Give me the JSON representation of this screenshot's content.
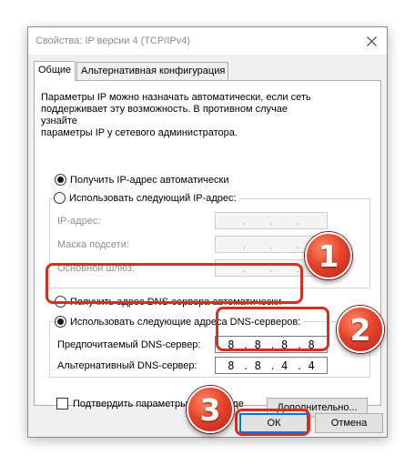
{
  "window": {
    "title": "Свойства: IP версии 4 (TCP/IPv4)"
  },
  "tabs": [
    {
      "label": "Общие",
      "active": true
    },
    {
      "label": "Альтернативная конфигурация",
      "active": false
    }
  ],
  "general": {
    "description": "Параметры IP можно назначать автоматически, если сеть\nподдерживает эту возможность. В противном случае узнайте\nпараметры IP у сетевого администратора.",
    "ip_auto_label": "Получить IP-адрес автоматически",
    "ip_auto_selected": true,
    "ip_manual_label": "Использовать следующий IP-адрес:",
    "ip_manual_selected": false,
    "ip_fields": {
      "ip_label": "IP-адрес:",
      "mask_label": "Маска подсети:",
      "gateway_label": "Основной шлюз:"
    },
    "dns_auto_label": "Получить адрес DNS-сервера автоматически",
    "dns_auto_selected": false,
    "dns_manual_label": "Использовать следующие адреса DNS-серверов:",
    "dns_manual_selected": true,
    "dns_fields": {
      "preferred_label": "Предпочитаемый DNS-сервер:",
      "preferred_value": [
        "8",
        "8",
        "8",
        "8"
      ],
      "alternate_label": "Альтернативный DNS-сервер:",
      "alternate_value": [
        "8",
        "8",
        "4",
        "4"
      ]
    },
    "validate_label": "Подтвердить параметры при выходе",
    "validate_checked": false,
    "advanced_button": "Дополнительно..."
  },
  "buttons": {
    "ok": "ОК",
    "cancel": "Отмена"
  },
  "annotations": {
    "badge1": "1",
    "badge2": "2",
    "badge3": "3",
    "highlight_color": "#d32f23"
  },
  "icons": {
    "close": "close-icon",
    "radio": "radio-button-icon",
    "checkbox": "checkbox-icon"
  }
}
